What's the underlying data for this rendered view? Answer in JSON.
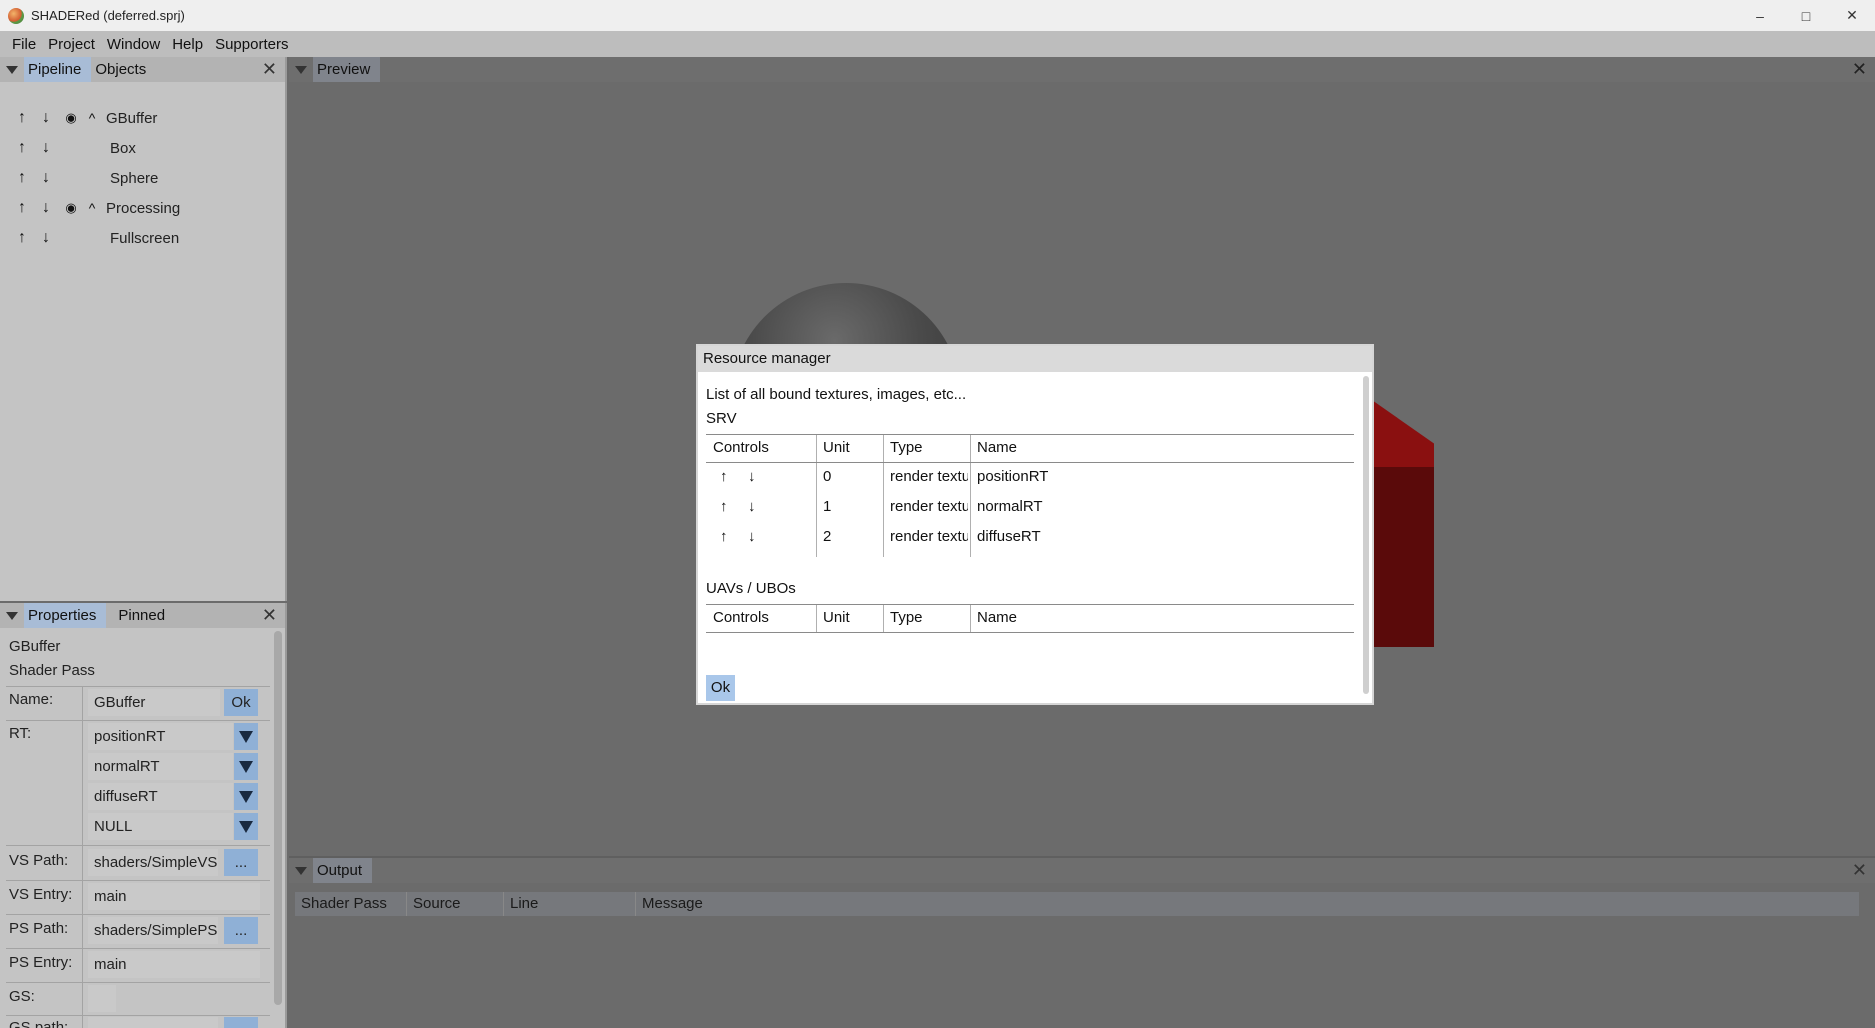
{
  "window": {
    "title": "SHADERed (deferred.sprj)",
    "minimize": "–",
    "maximize": "□",
    "close": "✕"
  },
  "menubar": [
    "File",
    "Project",
    "Window",
    "Help",
    "Supporters"
  ],
  "pipeline_panel": {
    "tabs": [
      "Pipeline",
      "Objects"
    ],
    "items": [
      {
        "label": "GBuffer",
        "type": "pass"
      },
      {
        "label": "Box",
        "type": "item"
      },
      {
        "label": "Sphere",
        "type": "item"
      },
      {
        "label": "Processing",
        "type": "pass"
      },
      {
        "label": "Fullscreen",
        "type": "item"
      }
    ]
  },
  "properties_panel": {
    "tabs": [
      "Properties",
      "Pinned"
    ],
    "object_name": "GBuffer",
    "object_type": "Shader Pass",
    "name_label": "Name:",
    "name_value": "GBuffer",
    "name_ok": "Ok",
    "rt_label": "RT:",
    "rt_values": [
      "positionRT",
      "normalRT",
      "diffuseRT",
      "NULL"
    ],
    "vs_path_label": "VS Path:",
    "vs_path_value": "shaders/SimpleVS",
    "vs_entry_label": "VS Entry:",
    "vs_entry_value": "main",
    "ps_path_label": "PS Path:",
    "ps_path_value": "shaders/SimplePS",
    "ps_entry_label": "PS Entry:",
    "ps_entry_value": "main",
    "gs_label": "GS:",
    "gs_path_label": "GS path:",
    "browse": "..."
  },
  "preview_panel": {
    "tab": "Preview"
  },
  "output_panel": {
    "tab": "Output",
    "columns": [
      "Shader Pass",
      "Source",
      "Line",
      "Message"
    ]
  },
  "resource_manager": {
    "title": "Resource manager",
    "description": "List of all bound textures, images, etc...",
    "srv_heading": "SRV",
    "columns": [
      "Controls",
      "Unit",
      "Type",
      "Name"
    ],
    "srv_rows": [
      {
        "unit": "0",
        "type": "render texture",
        "name": "positionRT"
      },
      {
        "unit": "1",
        "type": "render texture",
        "name": "normalRT"
      },
      {
        "unit": "2",
        "type": "render texture",
        "name": "diffuseRT"
      }
    ],
    "uav_heading": "UAVs / UBOs",
    "ok": "Ok"
  },
  "icons": {
    "up": "↑",
    "down": "↓",
    "eye": "👁",
    "collapse": "^",
    "close": "✕"
  }
}
